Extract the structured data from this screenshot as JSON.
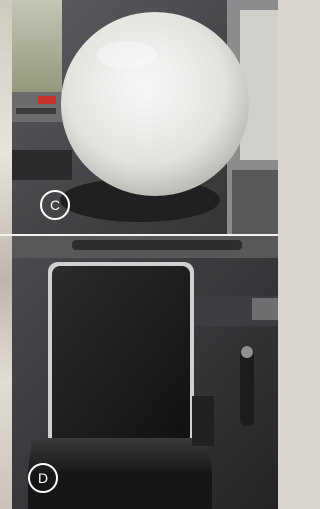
{
  "panels": [
    {
      "label": "C",
      "subject": "airbag"
    },
    {
      "label": "D",
      "subject": "tablet-holder"
    }
  ],
  "colors": {
    "airbag": "#ececea",
    "dashboard": "#3e3f41",
    "tablet_screen": "#1e1e20",
    "label_ring": "#ffffff"
  }
}
